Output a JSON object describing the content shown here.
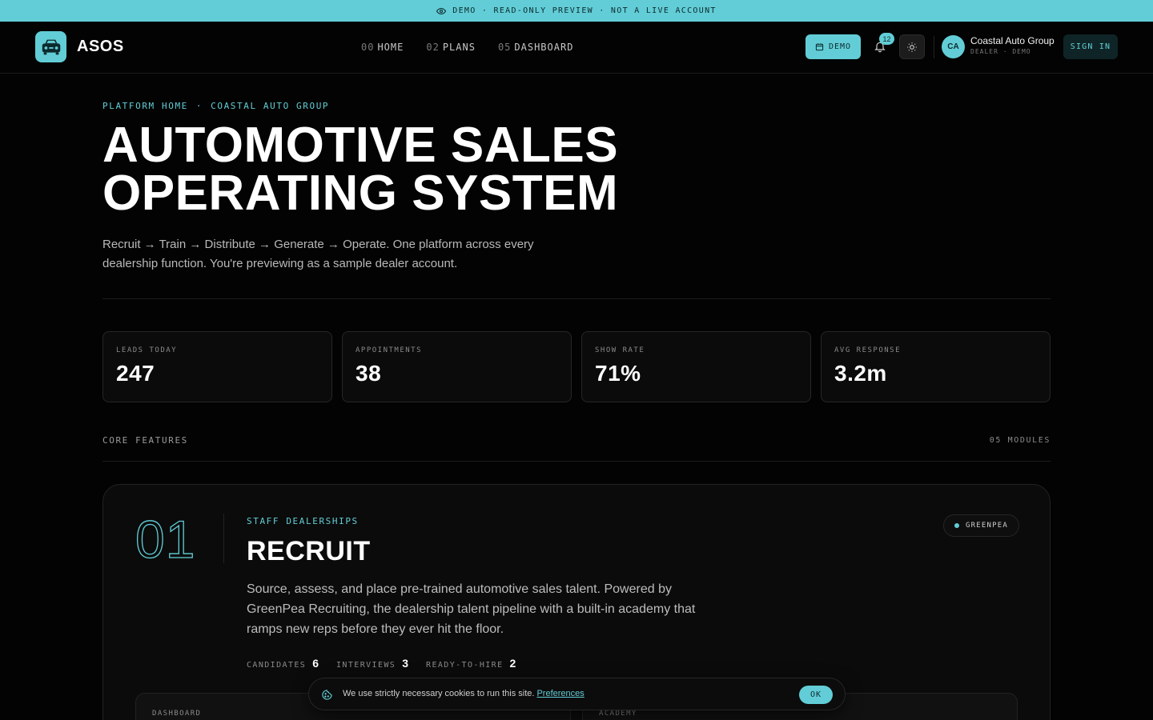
{
  "banner": {
    "text": "DEMO · READ-ONLY PREVIEW · NOT A LIVE ACCOUNT",
    "icon": "eye-icon"
  },
  "header": {
    "logo_text": "ASOS",
    "nav": [
      {
        "num": "00",
        "label": "HOME"
      },
      {
        "num": "02",
        "label": "PLANS"
      },
      {
        "num": "05",
        "label": "DASHBOARD"
      }
    ],
    "demo_label": "DEMO",
    "notification_count": "12",
    "account": {
      "initials": "CA",
      "name": "Coastal Auto Group",
      "role": "DEALER · DEMO"
    },
    "signin_label": "SIGN IN"
  },
  "hero": {
    "crumb": [
      "PLATFORM HOME",
      "·",
      "COASTAL AUTO GROUP"
    ],
    "title_lines": [
      "AUTOMOTIVE SALES",
      "OPERATING SYSTEM"
    ],
    "description": "Recruit → Train → Distribute → Generate → Operate. One platform across every dealership function. You're previewing as a sample dealer account."
  },
  "stats": [
    {
      "label": "LEADS TODAY",
      "value": "247"
    },
    {
      "label": "APPOINTMENTS",
      "value": "38"
    },
    {
      "label": "SHOW RATE",
      "value": "71%"
    },
    {
      "label": "AVG RESPONSE",
      "value": "3.2m"
    }
  ],
  "section": {
    "title": "CORE FEATURES",
    "count": "05 MODULES"
  },
  "feature": {
    "number": "01",
    "kicker": "STAFF DEALERSHIPS",
    "title": "RECRUIT",
    "description": "Source, assess, and place pre-trained automotive sales talent. Powered by GreenPea Recruiting, the dealership talent pipeline with a built-in academy that ramps new reps before they ever hit the floor.",
    "metrics": [
      {
        "label": "CANDIDATES",
        "value": "6"
      },
      {
        "label": "INTERVIEWS",
        "value": "3"
      },
      {
        "label": "READY-TO-HIRE",
        "value": "2"
      }
    ],
    "partner": "GREENPEA",
    "panels": [
      "DASHBOARD",
      "ACADEMY"
    ]
  },
  "cookie": {
    "text": "We use strictly necessary cookies to run this site.",
    "link": "Preferences",
    "ok": "OK"
  },
  "colors": {
    "accent": "#62cdd6",
    "background": "#030303",
    "card": "#0b0b0b"
  }
}
